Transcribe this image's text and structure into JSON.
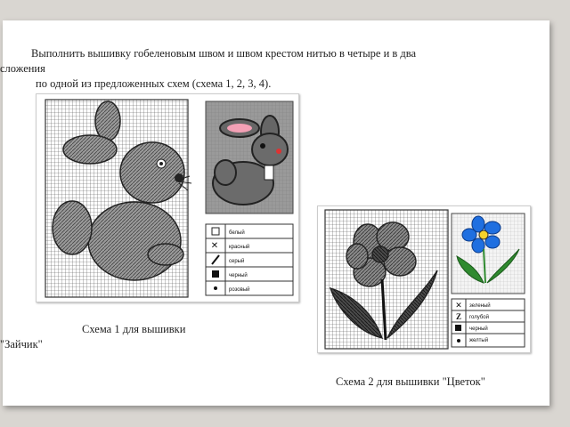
{
  "intro": {
    "line1": "Выполнить вышивку гобеленовым швом и швом крестом нитью в четыре и в два",
    "line2": "сложения",
    "line3": "по одной из предложенных схем (схема 1, 2, 3, 4)."
  },
  "scheme1": {
    "caption_line1": "Схема 1 для вышивки",
    "caption_line2": "\"Зайчик\"",
    "legend": [
      {
        "symbol": "blank-box",
        "label": "белый"
      },
      {
        "symbol": "cross",
        "label": "красный"
      },
      {
        "symbol": "slash",
        "label": "серый"
      },
      {
        "symbol": "filled-square",
        "label": "черный"
      },
      {
        "symbol": "dot",
        "label": "розовый"
      }
    ]
  },
  "scheme2": {
    "caption": "Схема 2 для вышивки \"Цветок\"",
    "legend": [
      {
        "symbol": "cross",
        "label": "зеленый"
      },
      {
        "symbol": "z-mark",
        "label": "голубой"
      },
      {
        "symbol": "filled-square",
        "label": "черный"
      },
      {
        "symbol": "dot",
        "label": "желтый"
      }
    ]
  },
  "colors": {
    "background": "#d9d6d1",
    "grid": "#555555",
    "stitch_gray": "#8a8a8a",
    "photo_gray": "#9a9a9a",
    "rabbit_fill": "#6b6b6b",
    "rabbit_ear": "#f3a0b5",
    "flower_blue": "#1f6fe0",
    "flower_center": "#f5d22a",
    "leaf_green": "#2f8a2f"
  }
}
